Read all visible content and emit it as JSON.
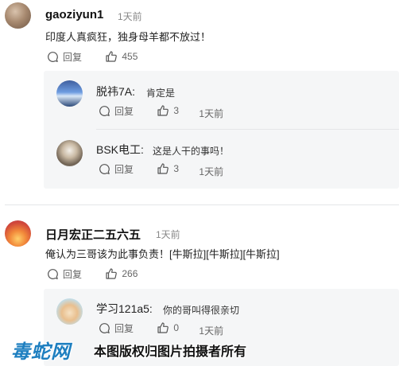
{
  "comments": [
    {
      "username": "gaoziyun1",
      "time": "1天前",
      "text": "印度人真疯狂，独身母羊都不放过！",
      "reply_label": "回复",
      "likes": "455",
      "replies": [
        {
          "username": "脱祎7A:",
          "text": "肯定是",
          "reply_label": "回复",
          "likes": "3",
          "time": "1天前"
        },
        {
          "username": "BSK电工:",
          "text": "这是人干的事吗！",
          "reply_label": "回复",
          "likes": "3",
          "time": "1天前"
        }
      ]
    },
    {
      "username": "日月宏正二五六五",
      "time": "1天前",
      "text": "俺认为三哥该为此事负责！[牛斯拉][牛斯拉][牛斯拉]",
      "reply_label": "回复",
      "likes": "266",
      "replies": [
        {
          "username": "学习121a5:",
          "text": "你的哥叫得很亲切",
          "reply_label": "回复",
          "likes": "0",
          "time": "1天前"
        }
      ]
    }
  ],
  "watermark": {
    "logo": "毒蛇网",
    "text": "本图版权归图片拍摄者所有"
  },
  "colors": {
    "watermark_logo": "#1e7fc0",
    "reply_bg": "#f5f6f7"
  }
}
